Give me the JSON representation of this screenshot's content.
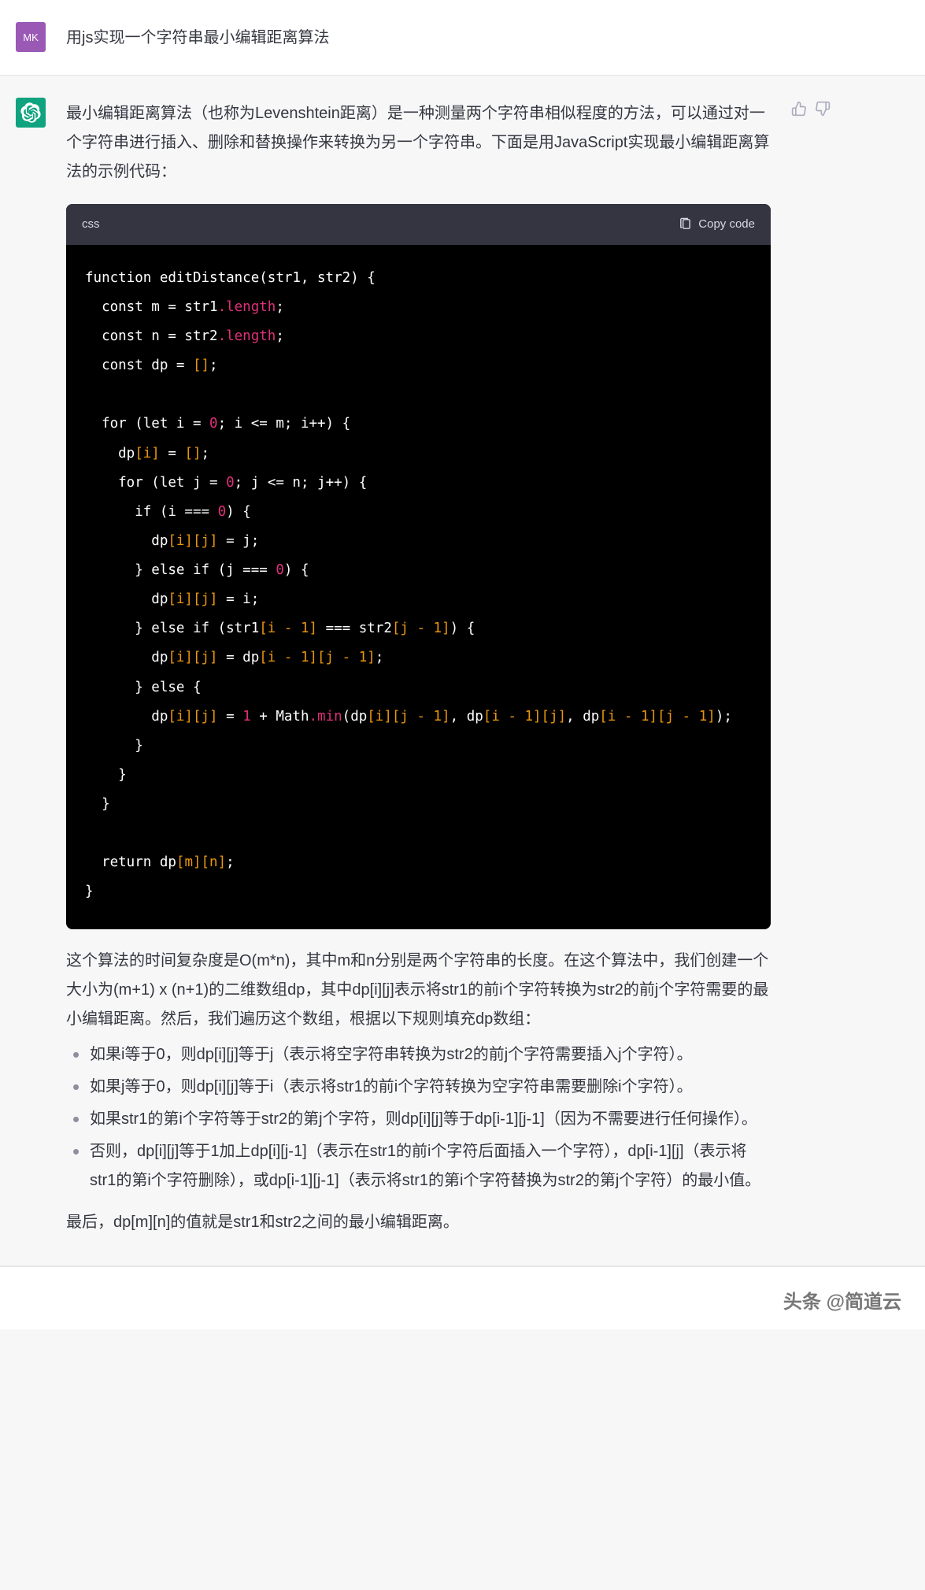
{
  "user": {
    "avatar": "MK",
    "message": "用js实现一个字符串最小编辑距离算法"
  },
  "assistant": {
    "intro": "最小编辑距离算法（也称为Levenshtein距离）是一种测量两个字符串相似程度的方法，可以通过对一个字符串进行插入、删除和替换操作来转换为另一个字符串。下面是用JavaScript实现最小编辑距离算法的示例代码：",
    "code_lang": "css",
    "copy_label": "Copy code",
    "explain1": "这个算法的时间复杂度是O(m*n)，其中m和n分别是两个字符串的长度。在这个算法中，我们创建一个大小为(m+1) x (n+1)的二维数组dp，其中dp[i][j]表示将str1的前i个字符转换为str2的前j个字符需要的最小编辑距离。然后，我们遍历这个数组，根据以下规则填充dp数组：",
    "bullets": [
      "如果i等于0，则dp[i][j]等于j（表示将空字符串转换为str2的前j个字符需要插入j个字符）。",
      "如果j等于0，则dp[i][j]等于i（表示将str1的前i个字符转换为空字符串需要删除i个字符）。",
      "如果str1的第i个字符等于str2的第j个字符，则dp[i][j]等于dp[i-1][j-1]（因为不需要进行任何操作）。",
      "否则，dp[i][j]等于1加上dp[i][j-1]（表示在str1的前i个字符后面插入一个字符），dp[i-1][j]（表示将str1的第i个字符删除），或dp[i-1][j-1]（表示将str1的第i个字符替换为str2的第j个字符）的最小值。"
    ],
    "explain2": "最后，dp[m][n]的值就是str1和str2之间的最小编辑距离。"
  },
  "code": {
    "l1a": "function editDistance(str1, str2) {",
    "l2a": "  const m = str1",
    "l2b": ".length",
    "l2c": ";",
    "l3a": "  const n = str2",
    "l3b": ".length",
    "l3c": ";",
    "l4a": "  const dp = ",
    "l4b": "[]",
    "l4c": ";",
    "l6a": "  for (let i = ",
    "l6b": "0",
    "l6c": "; i <= m; i++) {",
    "l7a": "    dp",
    "l7b": "[i]",
    "l7c": " = ",
    "l7d": "[]",
    "l7e": ";",
    "l8a": "    for (let j = ",
    "l8b": "0",
    "l8c": "; j <= n; j++) {",
    "l9a": "      if (i === ",
    "l9b": "0",
    "l9c": ") {",
    "l10a": "        dp",
    "l10b": "[i][j]",
    "l10c": " = j;",
    "l11a": "      } else if (j === ",
    "l11b": "0",
    "l11c": ") {",
    "l12a": "        dp",
    "l12b": "[i][j]",
    "l12c": " = i;",
    "l13a": "      } else if (str1",
    "l13b": "[i - 1]",
    "l13c": " === str2",
    "l13d": "[j - 1]",
    "l13e": ") {",
    "l14a": "        dp",
    "l14b": "[i][j]",
    "l14c": " = dp",
    "l14d": "[i - 1][j - 1]",
    "l14e": ";",
    "l15a": "      } else {",
    "l16a": "        dp",
    "l16b": "[i][j]",
    "l16c": " = ",
    "l16d": "1",
    "l16e": " + Math",
    "l16f": ".min",
    "l16g": "(dp",
    "l16h": "[i][j - 1]",
    "l16i": ", dp",
    "l16j": "[i - 1][j]",
    "l16k": ", dp",
    "l16l": "[i - 1][j - 1]",
    "l16m": ");",
    "l17a": "      }",
    "l18a": "    }",
    "l19a": "  }",
    "l21a": "  return dp",
    "l21b": "[m][n]",
    "l21c": ";",
    "l22a": "}"
  },
  "watermark": "头条 @简道云"
}
